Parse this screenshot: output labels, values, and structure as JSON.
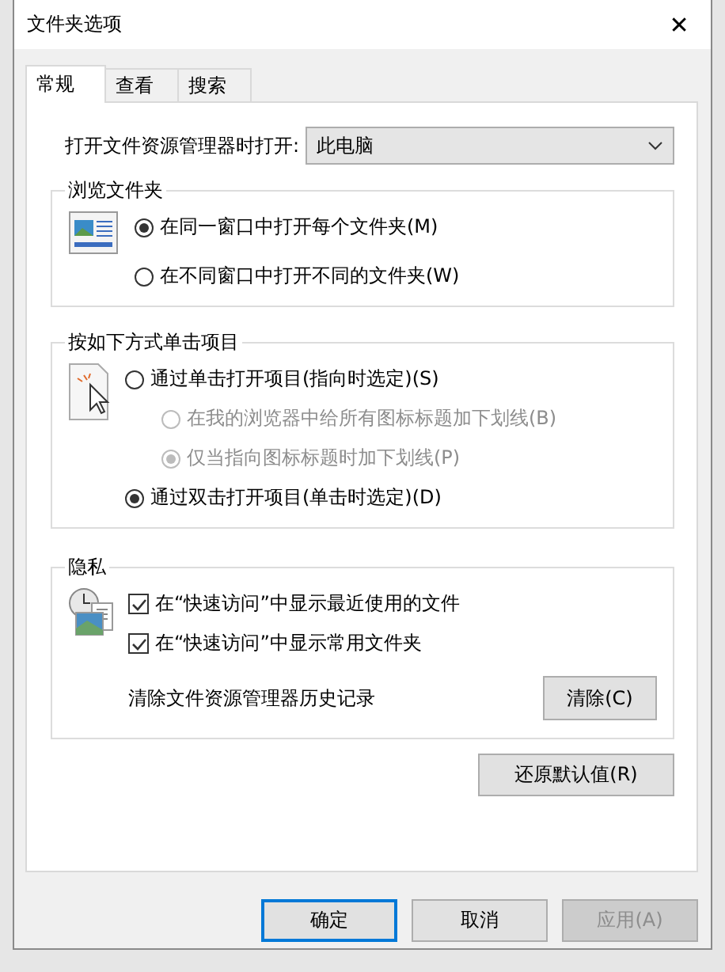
{
  "window": {
    "title": "文件夹选项",
    "close": "✕"
  },
  "tabs": [
    {
      "label": "常规",
      "selected": true
    },
    {
      "label": "查看",
      "selected": false
    },
    {
      "label": "搜索",
      "selected": false
    }
  ],
  "open_in": {
    "label": "打开文件资源管理器时打开:",
    "value": "此电脑"
  },
  "browse_folders": {
    "title": "浏览文件夹",
    "options": [
      {
        "label": "在同一窗口中打开每个文件夹(M)",
        "selected": true,
        "disabled": false
      },
      {
        "label": "在不同窗口中打开不同的文件夹(W)",
        "selected": false,
        "disabled": false
      }
    ]
  },
  "click_items": {
    "title": "按如下方式单击项目",
    "options": [
      {
        "label": "通过单击打开项目(指向时选定)(S)",
        "selected": false,
        "disabled": false,
        "children": [
          {
            "label": "在我的浏览器中给所有图标标题加下划线(B)",
            "selected": false,
            "disabled": true
          },
          {
            "label": "仅当指向图标标题时加下划线(P)",
            "selected": true,
            "disabled": true
          }
        ]
      },
      {
        "label": "通过双击打开项目(单击时选定)(D)",
        "selected": true,
        "disabled": false
      }
    ]
  },
  "privacy": {
    "title": "隐私",
    "checkboxes": [
      {
        "label": "在“快速访问”中显示最近使用的文件",
        "checked": true
      },
      {
        "label": "在“快速访问”中显示常用文件夹",
        "checked": true
      }
    ],
    "clear_label": "清除文件资源管理器历史记录",
    "clear_button": "清除(C)"
  },
  "restore_button": "还原默认值(R)",
  "buttons": [
    {
      "label": "确定",
      "default": true,
      "disabled": false
    },
    {
      "label": "取消",
      "default": false,
      "disabled": false
    },
    {
      "label": "应用(A)",
      "default": false,
      "disabled": true
    }
  ]
}
